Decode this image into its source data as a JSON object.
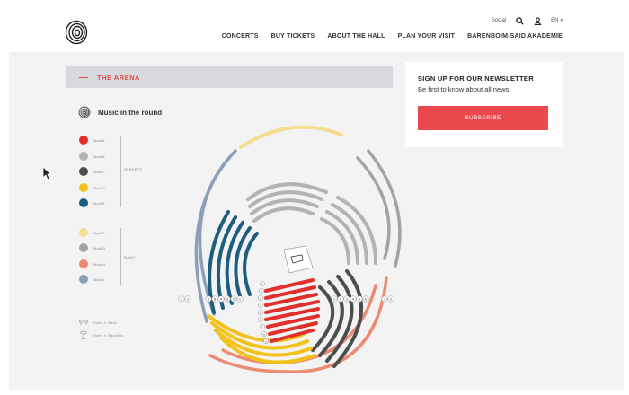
{
  "header": {
    "top_util": {
      "social_label": "Social",
      "lang_label": "EN"
    },
    "nav": [
      "CONCERTS",
      "BUY TICKETS",
      "ABOUT THE HALL",
      "PLAN YOUR VISIT",
      "BARENBOIM-SAID AKADEMIE"
    ]
  },
  "arena": {
    "title": "THE ARENA",
    "subtitle": "Music in the round"
  },
  "legend": {
    "blocks": [
      {
        "label": "Block A",
        "color": "#e0302c"
      },
      {
        "label": "Block B",
        "color": "#b3b3b3"
      },
      {
        "label": "Block C",
        "color": "#4a4e4f"
      },
      {
        "label": "Block D",
        "color": "#f2c21b"
      },
      {
        "label": "Block E",
        "color": "#1d5d80"
      },
      {
        "label": "Block F",
        "color": "#f5dc8f"
      },
      {
        "label": "Block G",
        "color": "#a3a3a3"
      },
      {
        "label": "Block H",
        "color": "#ec8a72"
      },
      {
        "label": "Block J",
        "color": "#8a9fb8"
      }
    ],
    "groups": {
      "parkett": "PARKETT",
      "rang": "RANG"
    },
    "keys": {
      "bench": "Reihe X: Bank",
      "stool": "Reihe X: Barstühle"
    }
  },
  "newsletter": {
    "title": "SIGN UP FOR OUR NEWSLETTER",
    "subtitle": "Be first to know about all news",
    "button": "SUBSCRIBE"
  },
  "seatmap": {
    "left_labels": [
      "2",
      "1",
      "6",
      "5",
      "4",
      "3",
      "2",
      "1"
    ],
    "right_labels": [
      "1",
      "2",
      "3",
      "4",
      "5",
      "6",
      "1",
      "2"
    ],
    "center_labels": [
      "1",
      "2",
      "3",
      "4",
      "5",
      "6",
      "7",
      "8",
      "9"
    ]
  }
}
